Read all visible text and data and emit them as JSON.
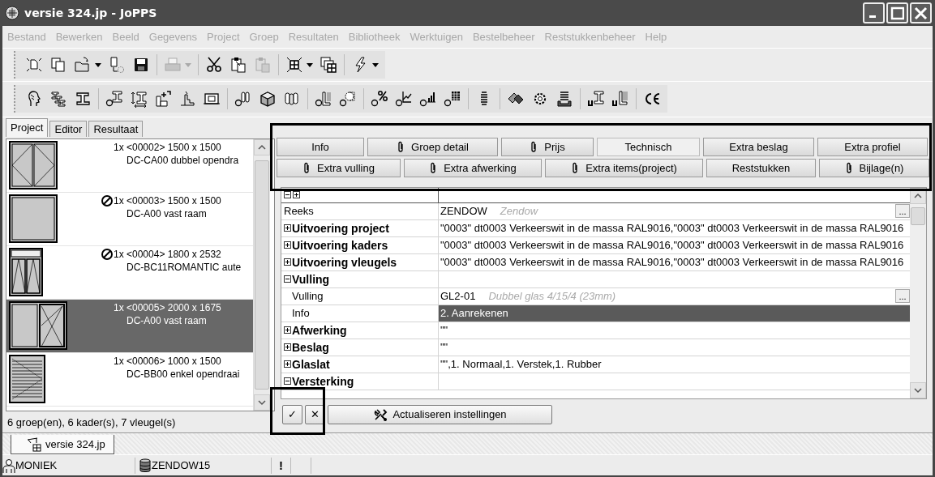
{
  "window": {
    "title": "versie 324.jp - JoPPS"
  },
  "menu": [
    {
      "label": "Bestand",
      "disabled": true
    },
    {
      "label": "Bewerken",
      "disabled": true
    },
    {
      "label": "Beeld",
      "disabled": true
    },
    {
      "label": "Gegevens",
      "disabled": true
    },
    {
      "label": "Project",
      "disabled": true
    },
    {
      "label": "Groep",
      "disabled": true
    },
    {
      "label": "Resultaten",
      "disabled": true
    },
    {
      "label": "Bibliotheek",
      "disabled": true
    },
    {
      "label": "Werktuigen",
      "disabled": true
    },
    {
      "label": "Bestelbeheer",
      "disabled": true
    },
    {
      "label": "Reststukkenbeheer",
      "disabled": true
    },
    {
      "label": "Help",
      "disabled": true
    }
  ],
  "project_panel": {
    "tabs": [
      {
        "label": "Project",
        "selected": true
      },
      {
        "label": "Editor",
        "selected": false
      },
      {
        "label": "Resultaat",
        "selected": false
      }
    ],
    "items": [
      {
        "header": "1x <00002> 1500 x 1500",
        "name": "DC-CA00 dubbel opendra",
        "kind": "double-casement",
        "blocked": false,
        "selected": false
      },
      {
        "header": "1x <00003> 1500 x 1500",
        "name": "DC-A00 vast raam",
        "kind": "fixed",
        "blocked": true,
        "selected": false
      },
      {
        "header": "1x <00004> 1800 x 2532",
        "name": "DC-BC11ROMANTIC aute",
        "kind": "transom-double",
        "blocked": true,
        "selected": false
      },
      {
        "header": "1x <00005> 2000 x 1675",
        "name": "DC-A00 vast raam",
        "kind": "fixed-casement",
        "blocked": false,
        "selected": true
      },
      {
        "header": "1x <00006> 1000 x 1500",
        "name": "DC-BB00 enkel opendraai",
        "kind": "louvered",
        "blocked": false,
        "selected": false
      }
    ],
    "summary": "6 groep(en), 6 kader(s), 7 vleugel(s)"
  },
  "detail_tab_rows": [
    {
      "tabs": [
        {
          "label": "Info",
          "attachment": false,
          "selected": false
        },
        {
          "label": "Groep detail",
          "attachment": true,
          "selected": false
        },
        {
          "label": "Prijs",
          "attachment": true,
          "selected": false
        },
        {
          "label": "Technisch",
          "attachment": false,
          "selected": true
        },
        {
          "label": "Extra beslag",
          "attachment": false,
          "selected": false
        },
        {
          "label": "Extra profiel",
          "attachment": false,
          "selected": false
        }
      ]
    },
    {
      "tabs": [
        {
          "label": "Extra vulling",
          "attachment": true,
          "selected": false
        },
        {
          "label": "Extra afwerking",
          "attachment": true,
          "selected": false
        },
        {
          "label": "Extra items(project)",
          "attachment": true,
          "selected": false
        },
        {
          "label": "Reststukken",
          "attachment": false,
          "selected": false
        },
        {
          "label": "Bijlage(n)",
          "attachment": true,
          "selected": false
        }
      ]
    }
  ],
  "properties": [
    {
      "kind": "property",
      "name": "Reeks",
      "value": "ZENDOW",
      "hint": "Zendow",
      "button": "...",
      "selected": false
    },
    {
      "kind": "category",
      "name": "Uitvoering project",
      "expanded": false,
      "value": "\"0003\" dt0003 Verkeerswit in de massa RAL9016,\"0003\" dt0003 Verkeerswit in de massa RAL9016",
      "selected": false
    },
    {
      "kind": "category",
      "name": "Uitvoering kaders",
      "expanded": false,
      "value": "\"0003\" dt0003 Verkeerswit in de massa RAL9016,\"0003\" dt0003 Verkeerswit in de massa RAL9016",
      "selected": false
    },
    {
      "kind": "category",
      "name": "Uitvoering vleugels",
      "expanded": false,
      "value": "\"0003\" dt0003 Verkeerswit in de massa RAL9016,\"0003\" dt0003 Verkeerswit in de massa RAL9016",
      "selected": false
    },
    {
      "kind": "category",
      "name": "Vulling",
      "expanded": true,
      "selected": false,
      "children": [
        {
          "kind": "property",
          "name": "Vulling",
          "value": "GL2-01",
          "hint": "Dubbel glas 4/15/4 (23mm)",
          "button": "...",
          "selected": false
        },
        {
          "kind": "property",
          "name": "Info",
          "value": "2. Aanrekenen",
          "selected": true
        }
      ]
    },
    {
      "kind": "category",
      "name": "Afwerking",
      "expanded": false,
      "value": "\"\"",
      "selected": false
    },
    {
      "kind": "category",
      "name": "Beslag",
      "expanded": false,
      "value": "\"\"",
      "selected": false
    },
    {
      "kind": "category",
      "name": "Glaslat",
      "expanded": false,
      "value": "\"\",1. Normaal,1. Verstek,1. Rubber",
      "selected": false
    },
    {
      "kind": "category",
      "name": "Versterking",
      "expanded": true,
      "selected": false
    }
  ],
  "actions": {
    "confirm": "✓",
    "cancel": "✕",
    "update": "Actualiseren instellingen"
  },
  "document_tabs": [
    {
      "label": "versie 324.jp"
    }
  ],
  "status_bar": {
    "user": "MONIEK",
    "database": "ZENDOW15",
    "alert": "!"
  }
}
